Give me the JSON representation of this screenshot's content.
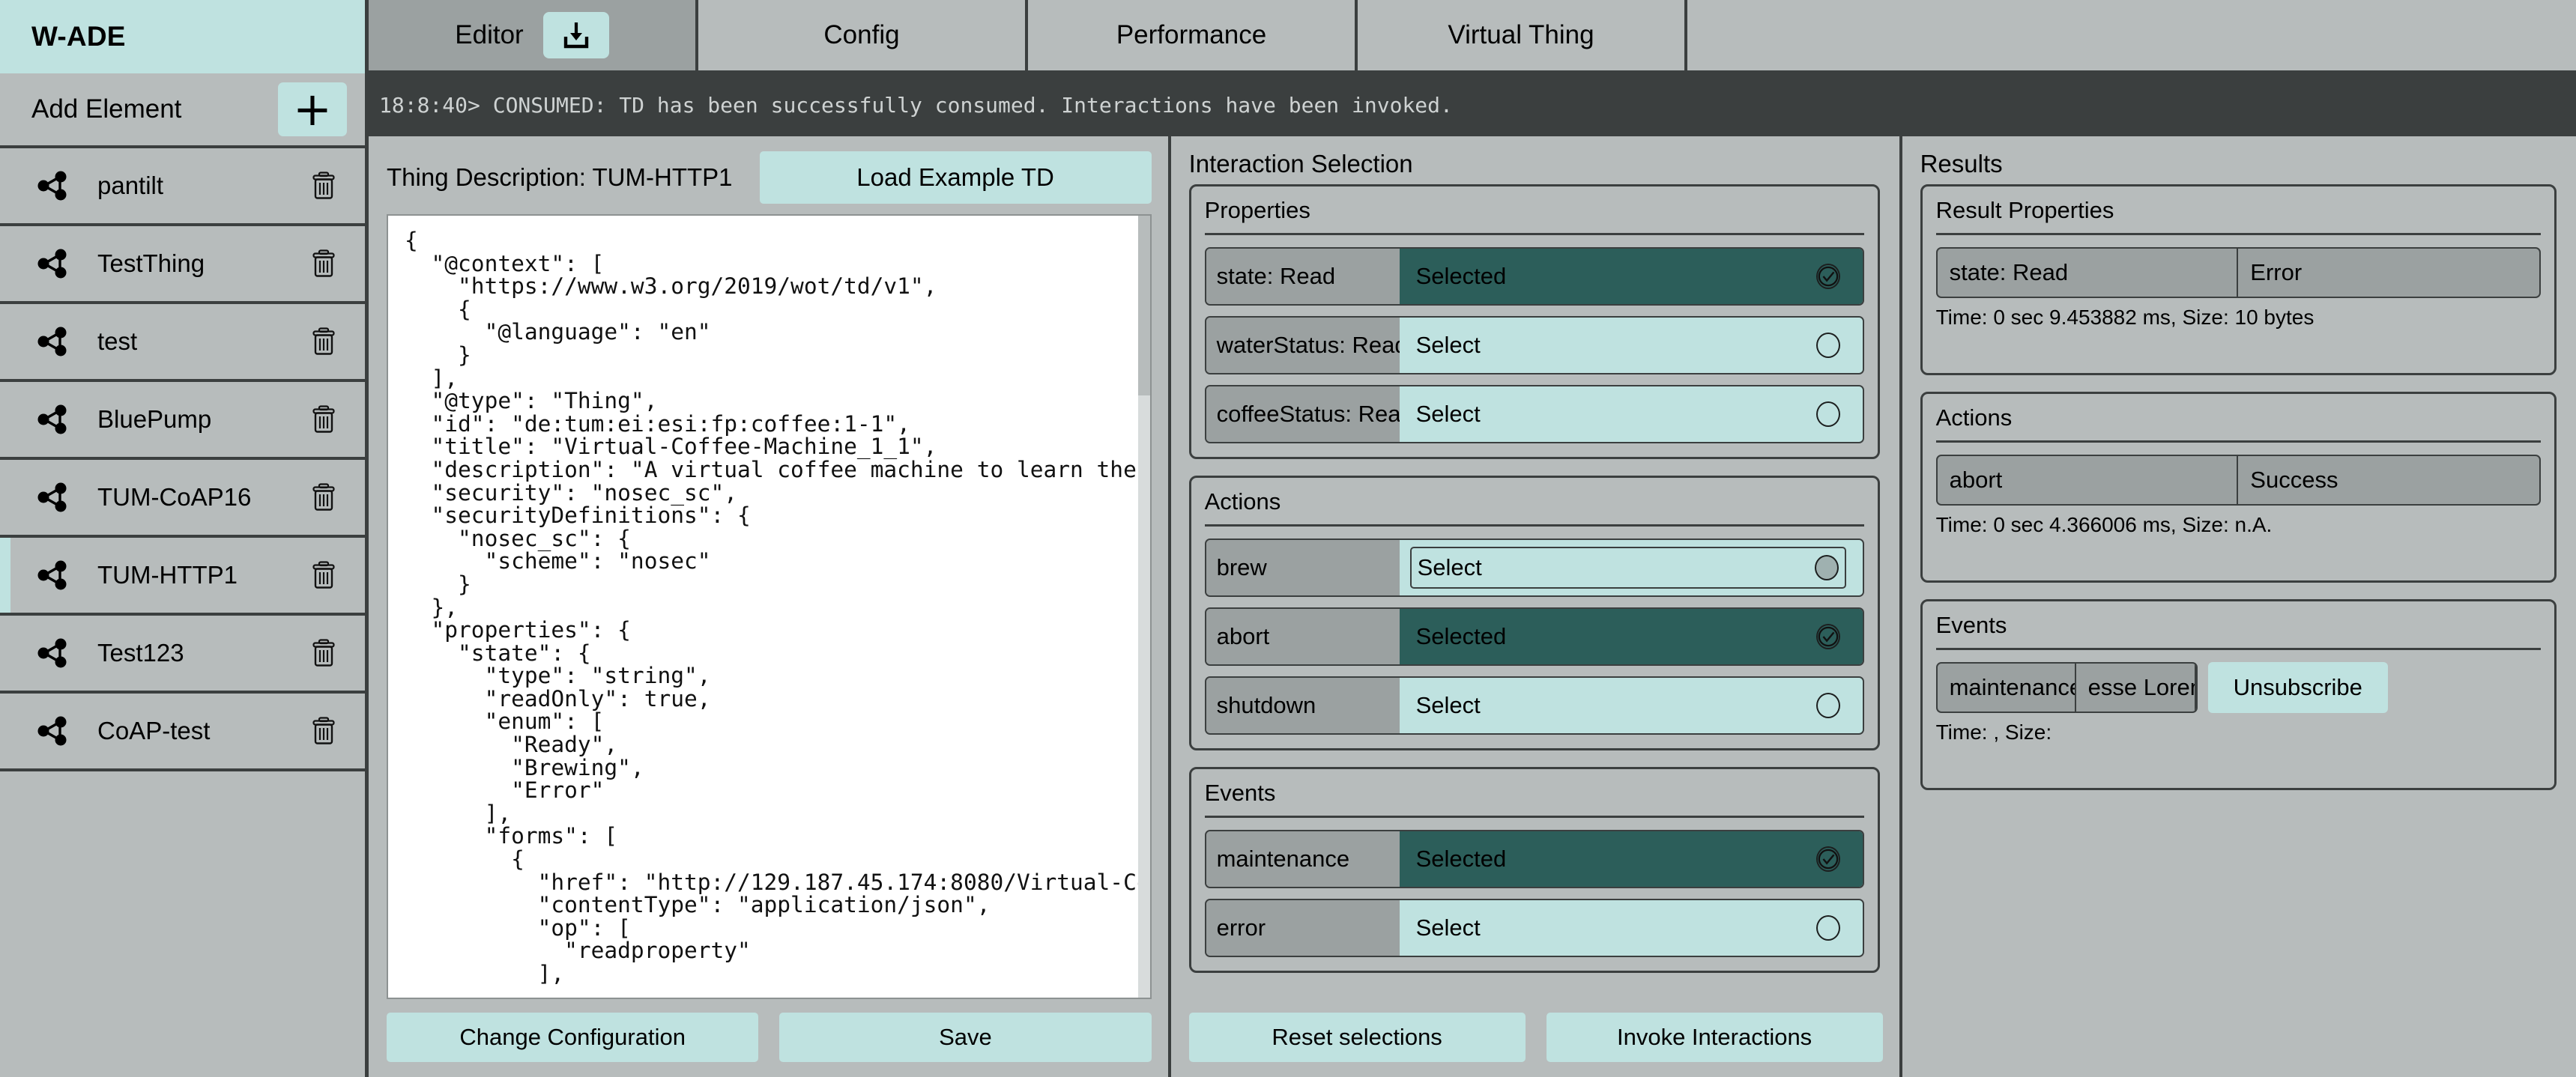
{
  "app": {
    "brand": "W-ADE"
  },
  "sidebar": {
    "add_element_label": "Add Element",
    "add_icon": "plus-icon",
    "thing_icon": "share-nodes-icon",
    "delete_icon": "trash-icon",
    "items": [
      {
        "label": "pantilt",
        "selected": false
      },
      {
        "label": "TestThing",
        "selected": false
      },
      {
        "label": "test",
        "selected": false
      },
      {
        "label": "BluePump",
        "selected": false
      },
      {
        "label": "TUM-CoAP16",
        "selected": false
      },
      {
        "label": "TUM-HTTP1",
        "selected": true
      },
      {
        "label": "Test123",
        "selected": false
      },
      {
        "label": "CoAP-test",
        "selected": false
      }
    ]
  },
  "tabs": [
    {
      "label": "Editor",
      "active": true,
      "has_download": true,
      "download_icon": "download-icon"
    },
    {
      "label": "Config",
      "active": false
    },
    {
      "label": "Performance",
      "active": false
    },
    {
      "label": "Virtual Thing",
      "active": false
    }
  ],
  "console": {
    "line": "18:8:40> CONSUMED: TD has been successfully consumed. Interactions have been invoked."
  },
  "editor": {
    "td_title": "Thing Description: TUM-HTTP1",
    "load_example_label": "Load Example TD",
    "td_json": "{\n  \"@context\": [\n    \"https://www.w3.org/2019/wot/td/v1\",\n    {\n      \"@language\": \"en\"\n    }\n  ],\n  \"@type\": \"Thing\",\n  \"id\": \"de:tum:ei:esi:fp:coffee:1-1\",\n  \"title\": \"Virtual-Coffee-Machine_1_1\",\n  \"description\": \"A virtual coffee machine to learn the\n  \"security\": \"nosec_sc\",\n  \"securityDefinitions\": {\n    \"nosec_sc\": {\n      \"scheme\": \"nosec\"\n    }\n  },\n  \"properties\": {\n    \"state\": {\n      \"type\": \"string\",\n      \"readOnly\": true,\n      \"enum\": [\n        \"Ready\",\n        \"Brewing\",\n        \"Error\"\n      ],\n      \"forms\": [\n        {\n          \"href\": \"http://129.187.45.174:8080/Virtual-Co\n          \"contentType\": \"application/json\",\n          \"op\": [\n            \"readproperty\"\n          ],",
    "buttons": [
      {
        "label": "Change Configuration"
      },
      {
        "label": "Save"
      }
    ]
  },
  "interaction": {
    "title": "Interaction Selection",
    "selected_label": "Selected",
    "unselected_label": "Select",
    "check_icon": "check-circle-icon",
    "empty_circle_icon": "circle-icon",
    "groups": [
      {
        "title": "Properties",
        "rows": [
          {
            "name": "state: Read",
            "state": "Selected",
            "selected": true,
            "focused": false
          },
          {
            "name": "waterStatus: Read",
            "state": "Select",
            "selected": false,
            "focused": false
          },
          {
            "name": "coffeeStatus: Read",
            "state": "Select",
            "selected": false,
            "focused": false
          }
        ]
      },
      {
        "title": "Actions",
        "rows": [
          {
            "name": "brew",
            "state": "Select",
            "selected": false,
            "focused": true
          },
          {
            "name": "abort",
            "state": "Selected",
            "selected": true,
            "focused": false
          },
          {
            "name": "shutdown",
            "state": "Select",
            "selected": false,
            "focused": false
          }
        ]
      },
      {
        "title": "Events",
        "rows": [
          {
            "name": "maintenance",
            "state": "Selected",
            "selected": true,
            "focused": false
          },
          {
            "name": "error",
            "state": "Select",
            "selected": false,
            "focused": false
          }
        ]
      }
    ],
    "buttons": [
      {
        "label": "Reset selections"
      },
      {
        "label": "Invoke Interactions"
      }
    ]
  },
  "results": {
    "title": "Results",
    "groups": [
      {
        "title": "Result Properties",
        "row": {
          "name": "state: Read",
          "value": "Error"
        },
        "meta": "Time: 0 sec 9.453882 ms, Size: 10 bytes"
      },
      {
        "title": "Actions",
        "row": {
          "name": "abort",
          "value": "Success"
        },
        "meta": "Time: 0 sec 4.366006 ms, Size: n.A."
      },
      {
        "title": "Events",
        "row": {
          "name": "maintenance",
          "value": "esse Lorem"
        },
        "unsubscribe_label": "Unsubscribe",
        "meta": "Time: , Size:"
      }
    ]
  },
  "colors": {
    "brand_teal": "#bfe2e0",
    "selected_teal": "#2c5e5a",
    "panel_gray": "#b7bcbc",
    "row_gray": "#9ba1a1",
    "dark": "#3b3f3f"
  }
}
